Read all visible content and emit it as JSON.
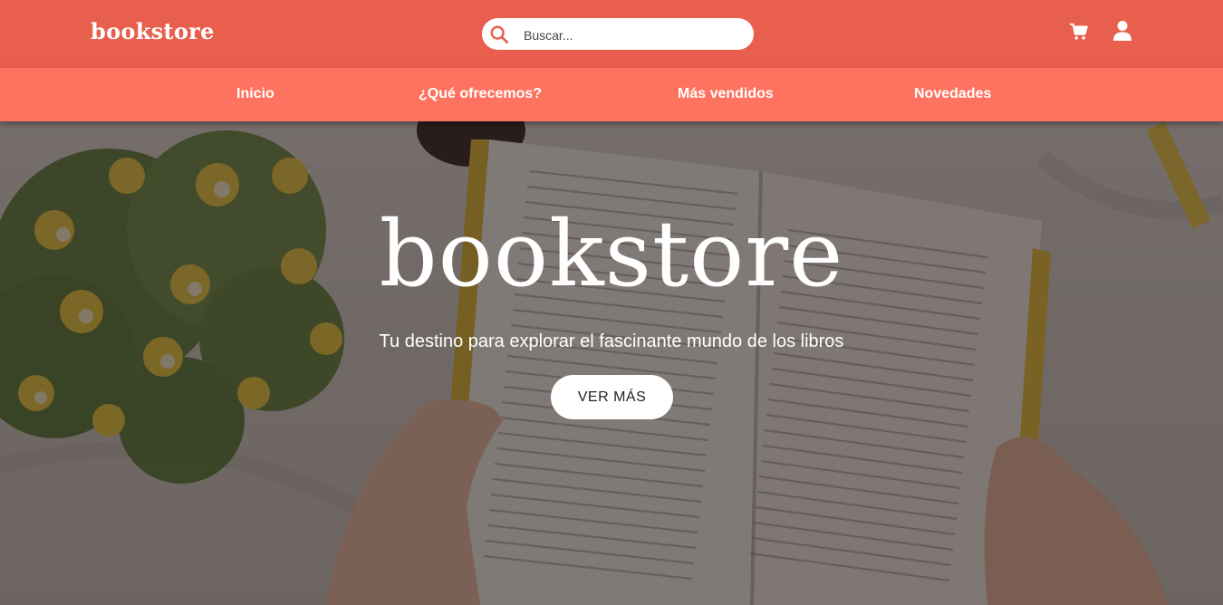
{
  "header": {
    "logo": "bookstore",
    "search": {
      "placeholder": "Buscar...",
      "value": ""
    },
    "icons": [
      "search-icon",
      "cart-icon",
      "user-icon"
    ]
  },
  "nav": {
    "items": [
      {
        "label": "Inicio"
      },
      {
        "label": "¿Qué ofrecemos?"
      },
      {
        "label": "Más vendidos"
      },
      {
        "label": "Novedades"
      }
    ]
  },
  "hero": {
    "title": "bookstore",
    "subtitle": "Tu destino para explorar el fascinante mundo de los libros",
    "button_label": "VER MÁS"
  },
  "colors": {
    "header_bg": "#e85f4d",
    "nav_bg": "#fe735f",
    "search_icon": "#e85f4d",
    "text_light": "#ffffff"
  }
}
